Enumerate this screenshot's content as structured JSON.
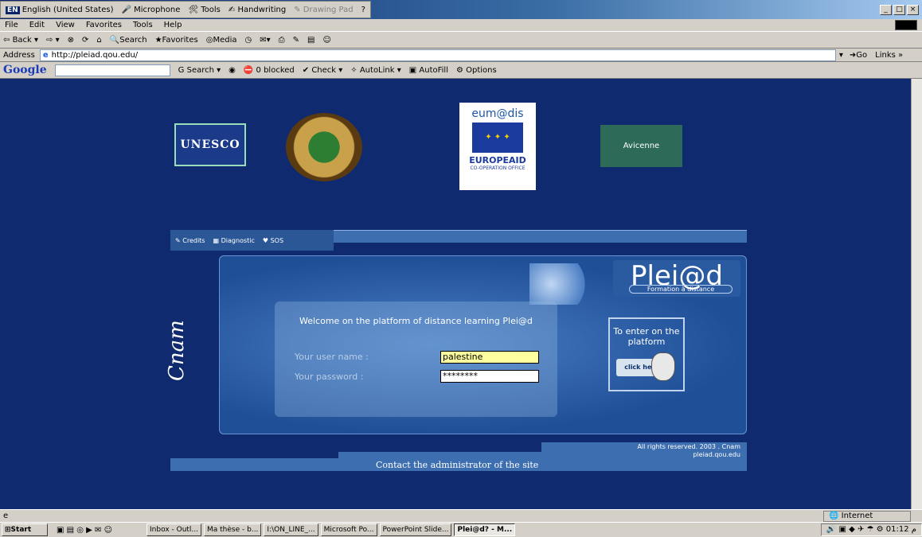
{
  "language_bar": {
    "lang_code": "EN",
    "language": "English (United States)",
    "items": [
      "Microphone",
      "Tools",
      "Handwriting",
      "Drawing Pad"
    ]
  },
  "menu": [
    "File",
    "Edit",
    "View",
    "Favorites",
    "Tools",
    "Help"
  ],
  "toolbar": {
    "back": "Back",
    "search": "Search",
    "favorites": "Favorites",
    "media": "Media"
  },
  "address": {
    "label": "Address",
    "url": "http://pleiad.qou.edu/",
    "go": "Go",
    "links": "Links"
  },
  "google_bar": {
    "logo": "Google",
    "search": "Search",
    "blocked": "0 blocked",
    "check": "Check",
    "autolink": "AutoLink",
    "autofill": "AutoFill",
    "options": "Options"
  },
  "page": {
    "logos": {
      "unesco": "UNESCO",
      "eumedis": "eum@dis",
      "europeaid": "EUROPEAID",
      "europeaid_sub": "CO-OPERATION OFFICE",
      "avicenne": "Avicenne"
    },
    "nav": [
      "Credits",
      "Diagnostic",
      "SOS"
    ],
    "brand": {
      "title": "Plei@d",
      "subtitle": "Formation à distance"
    },
    "welcome": "Welcome on the platform of distance learning Plei@d",
    "username_label": "Your user name :",
    "username_value": "palestine",
    "password_label": "Your password :",
    "password_value": "********",
    "enter_text": "To enter on the platform",
    "click_here": "click here",
    "cnam": "Cnam",
    "rights": "All rights reserved. 2003 . Cnam",
    "domain": "pleiad.qou.edu",
    "contact": "Contact the administrator of the site"
  },
  "status": {
    "zone": "Internet"
  },
  "taskbar": {
    "start": "Start",
    "tasks": [
      "Inbox - Outl...",
      "Ma thèse - b...",
      "I:\\ON_LINE_...",
      "Microsoft Po...",
      "PowerPoint Slide...",
      "Plei@d? - M..."
    ],
    "active_index": 5,
    "clock": "01:12 م"
  }
}
